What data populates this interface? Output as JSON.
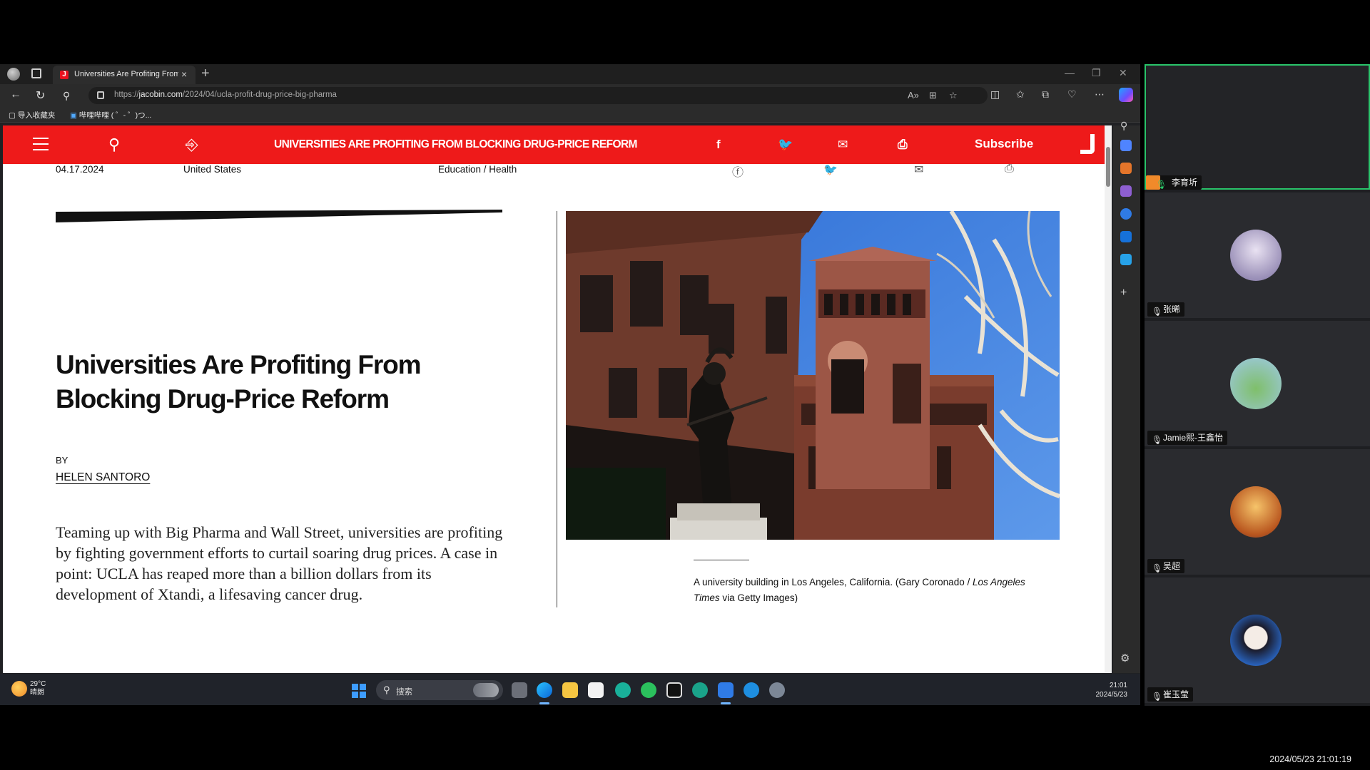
{
  "browser": {
    "tab_title": "Universities Are Profiting From B",
    "tab_close": "×",
    "new_tab": "+",
    "url_prefix": "https://",
    "url_domain": "jacobin.com",
    "url_path": "/2024/04/ucla-profit-drug-price-big-pharma",
    "favorites": [
      {
        "label": "导入收藏夹"
      },
      {
        "label": "哔哩哔哩 ( ゜- ゜)つ..."
      }
    ]
  },
  "site": {
    "header_title": "UNIVERSITIES ARE PROFITING FROM BLOCKING DRUG-PRICE REFORM",
    "subscribe": "Subscribe",
    "brand_color": "#ee1a1a"
  },
  "article": {
    "date": "04.17.2024",
    "location": "United States",
    "topics": "Education / Health",
    "title": "Universities Are Profiting From Blocking Drug-Price Reform",
    "by": "BY",
    "author": "HELEN SANTORO",
    "dek": "Teaming up with Big Pharma and Wall Street, universities are profiting by fighting government efforts to curtail soaring drug prices. A case in point: UCLA has reaped more than a billion dollars from its development of Xtandi, a lifesaving cancer drug.",
    "caption_main": "A university building in Los Angeles, California. (Gary Coronado / ",
    "caption_italic": "Los Angeles Times",
    "caption_end": " via Getty Images)"
  },
  "taskbar": {
    "temp": "29°C",
    "weather": "晴朗",
    "search": "搜索",
    "time": "21:01",
    "date": "2024/5/23"
  },
  "meeting": {
    "participants": [
      {
        "name": "李育圻",
        "mic": "on"
      },
      {
        "name": "张晞",
        "mic": "muted"
      },
      {
        "name": "Jamie熙-王鑫怡",
        "mic": "muted"
      },
      {
        "name": "吴超",
        "mic": "muted"
      },
      {
        "name": "崔玉莹",
        "mic": "muted"
      }
    ],
    "recording_timestamp": "2024/05/23 21:01:19"
  }
}
